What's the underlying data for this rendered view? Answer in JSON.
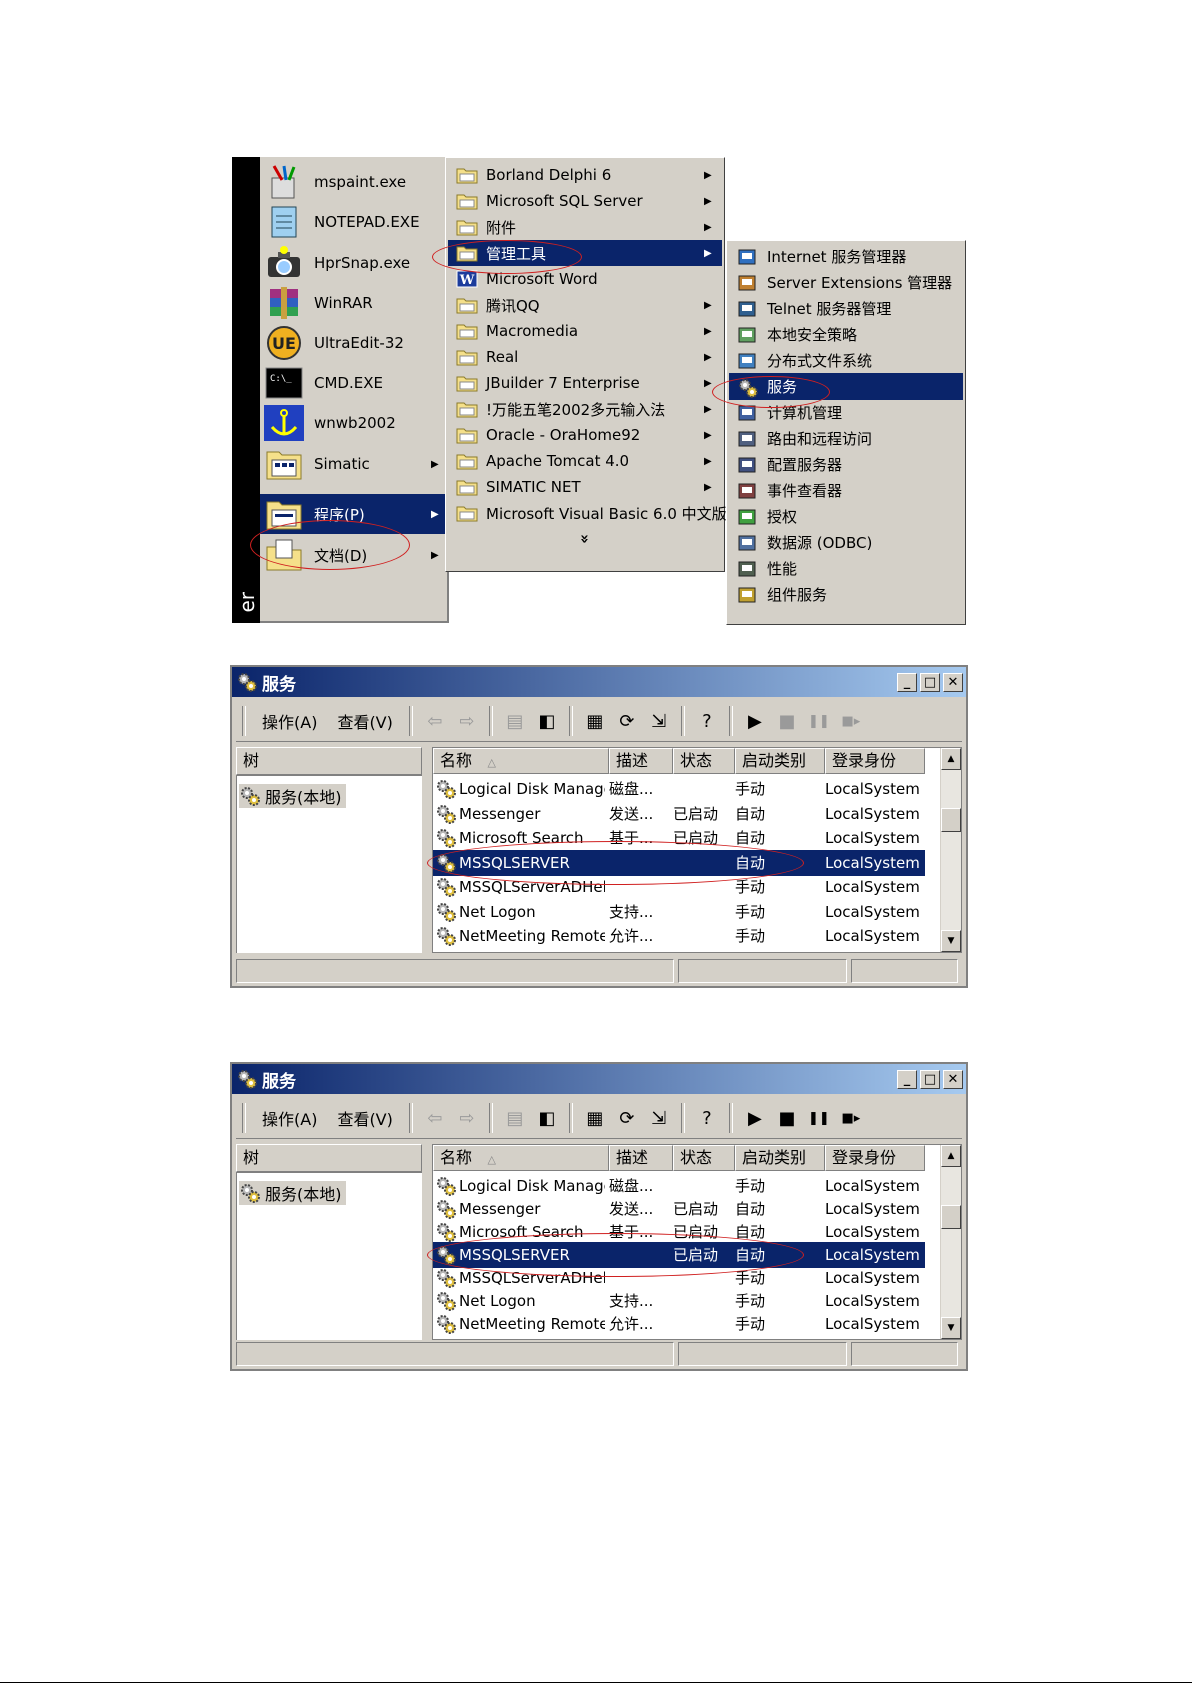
{
  "start_menu": {
    "banner_text": "er",
    "items": [
      {
        "label": "mspaint.exe",
        "icon": "paint-icon",
        "arrow": false
      },
      {
        "label": "NOTEPAD.EXE",
        "icon": "notepad-icon",
        "arrow": false
      },
      {
        "label": "HprSnap.exe",
        "icon": "camera-icon",
        "arrow": false
      },
      {
        "label": "WinRAR",
        "icon": "winrar-icon",
        "arrow": false
      },
      {
        "label": "UltraEdit-32",
        "icon": "ultraedit-icon",
        "arrow": false
      },
      {
        "label": "CMD.EXE",
        "icon": "cmd-icon",
        "arrow": false
      },
      {
        "label": "wnwb2002",
        "icon": "anchor-icon",
        "arrow": false
      },
      {
        "label": "Simatic",
        "icon": "simatic-icon",
        "arrow": true
      },
      {
        "label": "程序(P)",
        "icon": "programs-icon",
        "arrow": true,
        "highlighted": true
      },
      {
        "label": "文档(D)",
        "icon": "documents-icon",
        "arrow": true
      }
    ]
  },
  "programs_menu": {
    "items": [
      {
        "label": "Borland Delphi 6",
        "arrow": true
      },
      {
        "label": "Microsoft SQL Server",
        "arrow": true
      },
      {
        "label": "附件",
        "arrow": true
      },
      {
        "label": "管理工具",
        "arrow": true,
        "highlighted": true
      },
      {
        "label": "Microsoft Word",
        "arrow": false,
        "icon": "word-icon"
      },
      {
        "label": "腾讯QQ",
        "arrow": true
      },
      {
        "label": "Macromedia",
        "arrow": true
      },
      {
        "label": "Real",
        "arrow": true
      },
      {
        "label": "JBuilder 7 Enterprise",
        "arrow": true
      },
      {
        "label": "!万能五笔2002多元输入法",
        "arrow": true
      },
      {
        "label": "Oracle - OraHome92",
        "arrow": true
      },
      {
        "label": "Apache Tomcat 4.0",
        "arrow": true
      },
      {
        "label": "SIMATIC NET",
        "arrow": true
      },
      {
        "label": "Microsoft Visual Basic 6.0 中文版",
        "arrow": true
      }
    ],
    "more_glyph": "»"
  },
  "admin_tools_menu": {
    "items": [
      {
        "label": "Internet 服务管理器"
      },
      {
        "label": "Server Extensions 管理器"
      },
      {
        "label": "Telnet 服务器管理"
      },
      {
        "label": "本地安全策略"
      },
      {
        "label": "分布式文件系统"
      },
      {
        "label": "服务",
        "highlighted": true
      },
      {
        "label": "计算机管理"
      },
      {
        "label": "路由和远程访问"
      },
      {
        "label": "配置服务器"
      },
      {
        "label": "事件查看器"
      },
      {
        "label": "授权"
      },
      {
        "label": "数据源 (ODBC)"
      },
      {
        "label": "性能"
      },
      {
        "label": "组件服务"
      }
    ]
  },
  "services_window_1": {
    "title": "服务",
    "menu": {
      "action": "操作(A)",
      "view": "查看(V)"
    },
    "tree_header": "树",
    "tree_node": "服务(本地)",
    "columns": {
      "name": "名称",
      "desc": "描述",
      "status": "状态",
      "startup": "启动类别",
      "logon": "登录身份"
    },
    "rows": [
      {
        "name": "Logical Disk Manage...",
        "desc": "磁盘...",
        "status": "",
        "startup": "手动",
        "logon": "LocalSystem"
      },
      {
        "name": "Messenger",
        "desc": "发送...",
        "status": "已启动",
        "startup": "自动",
        "logon": "LocalSystem"
      },
      {
        "name": "Microsoft Search",
        "desc": "基于...",
        "status": "已启动",
        "startup": "自动",
        "logon": "LocalSystem"
      },
      {
        "name": "MSSQLSERVER",
        "desc": "",
        "status": "",
        "startup": "自动",
        "logon": "LocalSystem",
        "selected": true
      },
      {
        "name": "MSSQLServerADHel...",
        "desc": "",
        "status": "",
        "startup": "手动",
        "logon": "LocalSystem"
      },
      {
        "name": "Net Logon",
        "desc": "支持...",
        "status": "",
        "startup": "手动",
        "logon": "LocalSystem"
      },
      {
        "name": "NetMeeting Remote...",
        "desc": "允许...",
        "status": "",
        "startup": "手动",
        "logon": "LocalSystem"
      }
    ]
  },
  "services_window_2": {
    "title": "服务",
    "menu": {
      "action": "操作(A)",
      "view": "查看(V)"
    },
    "tree_header": "树",
    "tree_node": "服务(本地)",
    "columns": {
      "name": "名称",
      "desc": "描述",
      "status": "状态",
      "startup": "启动类别",
      "logon": "登录身份"
    },
    "rows": [
      {
        "name": "Logical Disk Manage...",
        "desc": "磁盘...",
        "status": "",
        "startup": "手动",
        "logon": "LocalSystem"
      },
      {
        "name": "Messenger",
        "desc": "发送...",
        "status": "已启动",
        "startup": "自动",
        "logon": "LocalSystem"
      },
      {
        "name": "Microsoft Search",
        "desc": "基于...",
        "status": "已启动",
        "startup": "自动",
        "logon": "LocalSystem"
      },
      {
        "name": "MSSQLSERVER",
        "desc": "",
        "status": "已启动",
        "startup": "自动",
        "logon": "LocalSystem",
        "selected": true
      },
      {
        "name": "MSSQLServerADHel...",
        "desc": "",
        "status": "",
        "startup": "手动",
        "logon": "LocalSystem"
      },
      {
        "name": "Net Logon",
        "desc": "支持...",
        "status": "",
        "startup": "手动",
        "logon": "LocalSystem"
      },
      {
        "name": "NetMeeting Remote...",
        "desc": "允许...",
        "status": "",
        "startup": "手动",
        "logon": "LocalSystem"
      }
    ]
  },
  "colors": {
    "highlight": "#0a246a",
    "face": "#d4d0c8",
    "annotation": "#d02020"
  }
}
